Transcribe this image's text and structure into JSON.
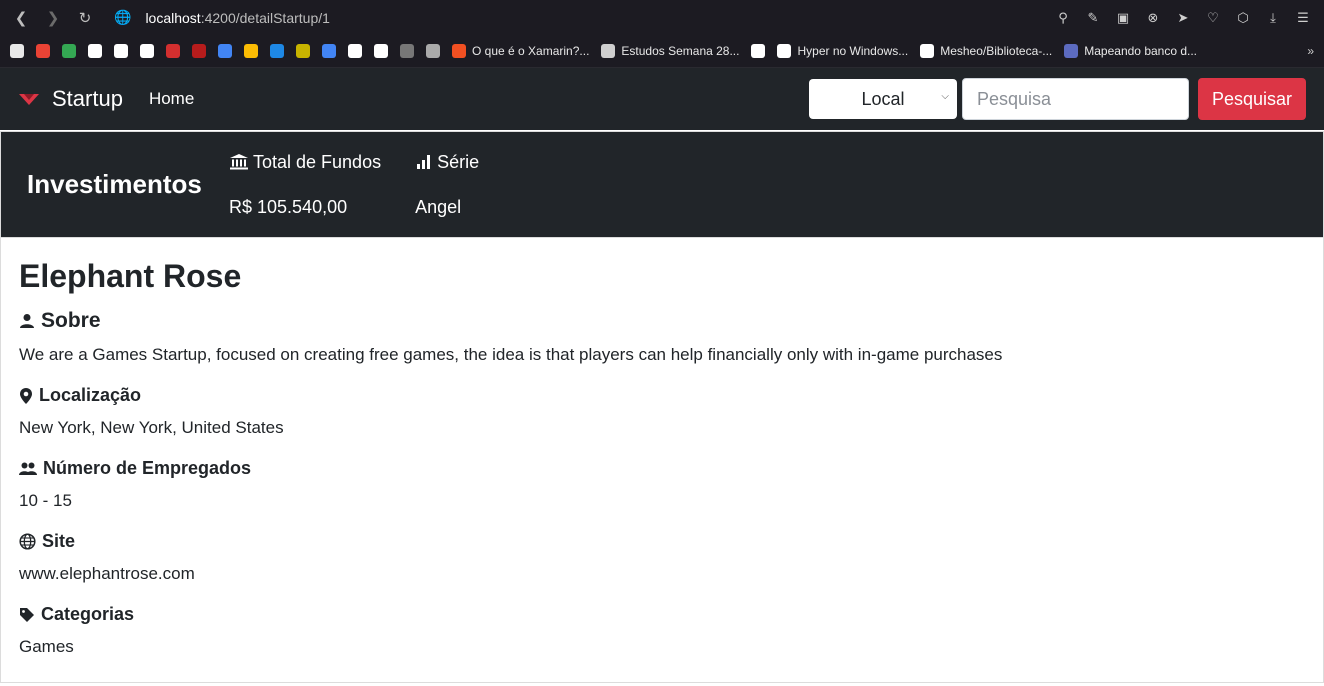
{
  "browser": {
    "url_host": "localhost",
    "url_path": ":4200/detailStartup/1",
    "bookmarks": [
      {
        "label": "",
        "color": "#e8e8e8"
      },
      {
        "label": "",
        "color": "#ea4335"
      },
      {
        "label": "",
        "color": "#34a853"
      },
      {
        "label": "",
        "color": "#ffffff"
      },
      {
        "label": "",
        "color": "#ffffff"
      },
      {
        "label": "",
        "color": "#ffffff"
      },
      {
        "label": "",
        "color": "#d32f2f"
      },
      {
        "label": "",
        "color": "#b71c1c"
      },
      {
        "label": "",
        "color": "#4285f4"
      },
      {
        "label": "",
        "color": "#fbbc04"
      },
      {
        "label": "",
        "color": "#1e88e5"
      },
      {
        "label": "",
        "color": "#c8b400"
      },
      {
        "label": "",
        "color": "#4285f4"
      },
      {
        "label": "",
        "color": "#ffffff"
      },
      {
        "label": "",
        "color": "#ffffff"
      },
      {
        "label": "",
        "color": "#777777"
      },
      {
        "label": "",
        "color": "#aaaaaa"
      },
      {
        "label": "O que é o Xamarin?...",
        "color": "#f25022"
      },
      {
        "label": "Estudos Semana 28...",
        "color": "#cfcfcf"
      },
      {
        "label": "",
        "color": "#ffffff"
      },
      {
        "label": "Hyper no Windows...",
        "color": "#ffffff"
      },
      {
        "label": "Mesheo/Biblioteca-...",
        "color": "#ffffff"
      },
      {
        "label": "Mapeando banco d...",
        "color": "#5c6bc0"
      }
    ]
  },
  "navbar": {
    "brand": "Startup",
    "home": "Home",
    "select_value": "Local",
    "search_placeholder": "Pesquisa",
    "search_button": "Pesquisar"
  },
  "invest": {
    "title": "Investimentos",
    "funds_label": "Total de Fundos",
    "funds_value": "R$ 105.540,00",
    "series_label": "Série",
    "series_value": "Angel"
  },
  "startup": {
    "name": "Elephant Rose",
    "about_label": "Sobre",
    "about_text": "We are a Games Startup, focused on creating free games, the idea is that players can help financially only with in-game purchases",
    "location_label": "Localização",
    "location_value": "New York, New York, United States",
    "employees_label": "Número de Empregados",
    "employees_value": "10 - 15",
    "site_label": "Site",
    "site_value": "www.elephantrose.com",
    "categories_label": "Categorias",
    "categories_value": "Games"
  },
  "colors": {
    "navbar_bg": "#212529",
    "accent_red": "#dc3545"
  }
}
